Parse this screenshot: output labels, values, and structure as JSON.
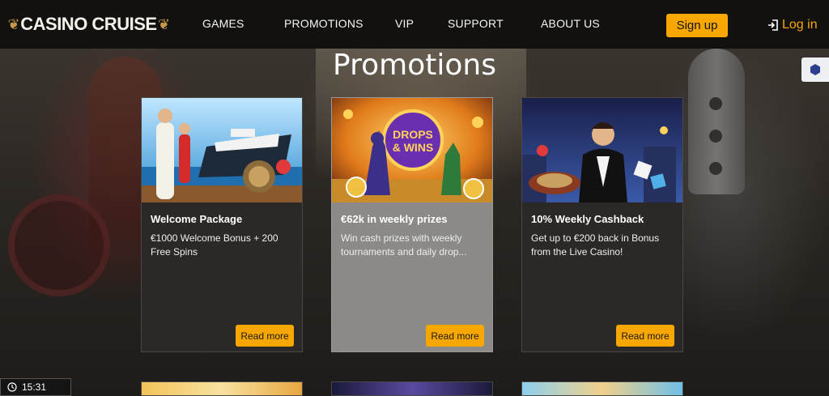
{
  "header": {
    "logo_left_glyph": "❦",
    "logo_text": "CASINO CRUISE",
    "logo_right_glyph": "❦",
    "nav": [
      {
        "label": "GAMES"
      },
      {
        "label": "PROMOTIONS"
      },
      {
        "label": "VIP"
      },
      {
        "label": "SUPPORT"
      },
      {
        "label": "ABOUT US"
      }
    ],
    "signup_label": "Sign up",
    "login_label": "Log in"
  },
  "page_title": "Promotions",
  "cards": [
    {
      "title": "Welcome Package",
      "description": "€1000 Welcome Bonus + 200 Free Spins",
      "button": "Read more"
    },
    {
      "title": "€62k in weekly prizes",
      "description": "Win cash prizes with weekly tournaments and daily drop...",
      "button": "Read more",
      "badge_line1": "DROPS",
      "badge_line2": "& WINS"
    },
    {
      "title": "10% Weekly Cashback",
      "description": "Get up to €200 back in Bonus from the Live Casino!",
      "button": "Read more"
    }
  ],
  "clock": "15:31",
  "colors": {
    "accent": "#f7a700",
    "header_bg": "#121110",
    "card_bg": "#2b2927",
    "card_hover_bg": "#8b8a89"
  }
}
